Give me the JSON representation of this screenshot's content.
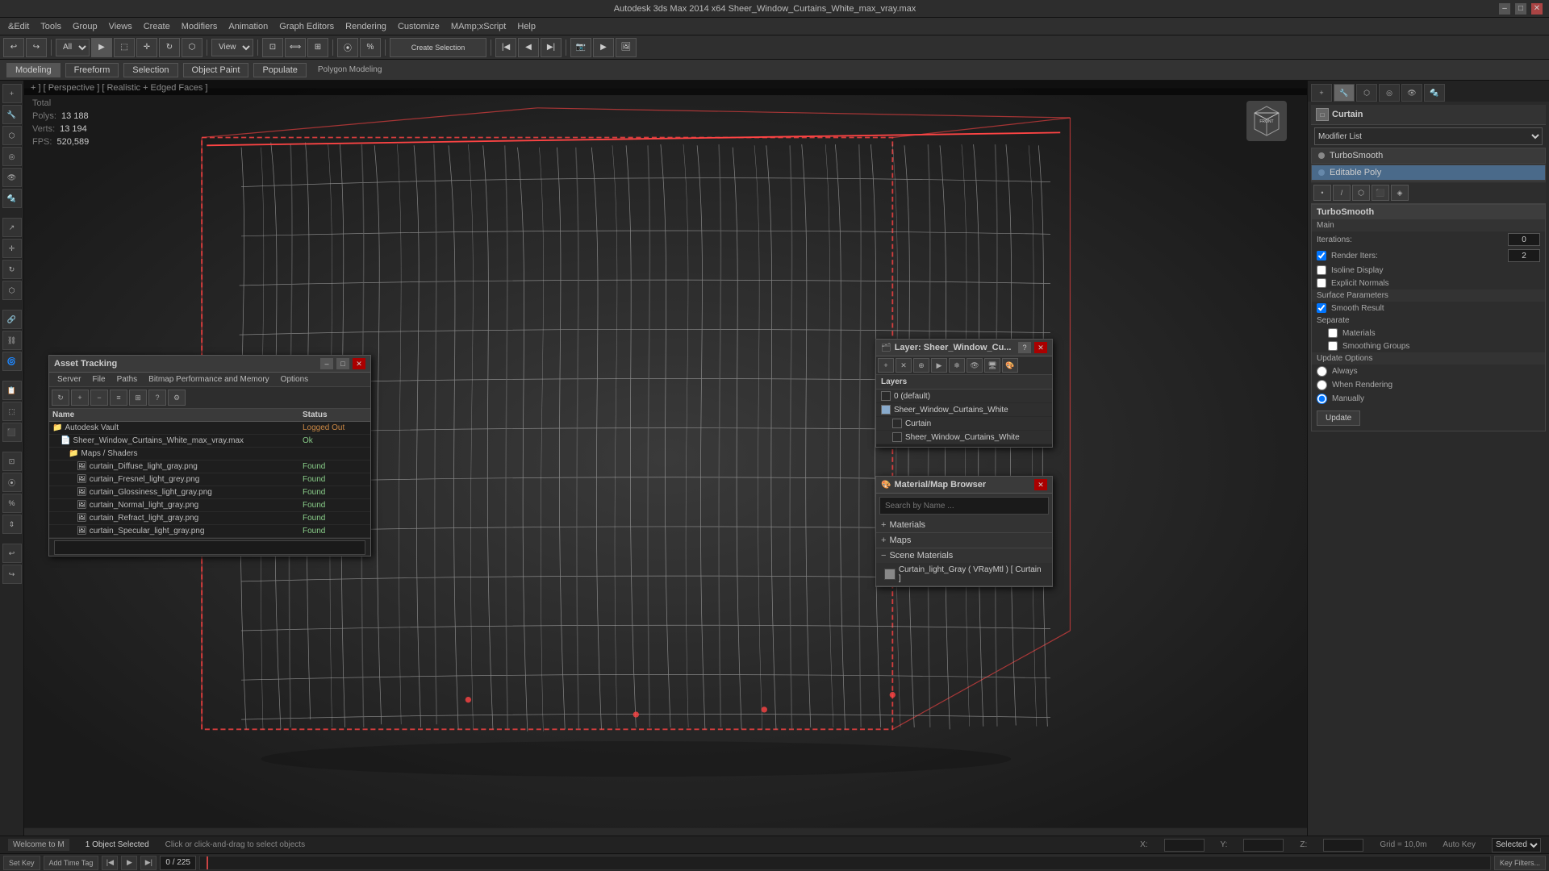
{
  "titlebar": {
    "title": "Autodesk 3ds Max  2014 x64    Sheer_Window_Curtains_White_max_vray.max",
    "minimize": "–",
    "maximize": "□",
    "close": "✕"
  },
  "menubar": {
    "items": [
      "&amp;Edit",
      "amp;Tools",
      "amp;Group",
      "amp;Views",
      "amp;Create",
      "amp;Modifiers",
      "amp;Animation",
      "Graph Editors",
      "amp;Rendering",
      "Camp;ustomize",
      "MAmp;xScript",
      "amp;Help"
    ]
  },
  "viewport": {
    "header": "+ ] [ Perspective ] [ Realistic + Edged Faces ]",
    "stats": {
      "total_label": "Total",
      "polys_label": "Polys:",
      "polys_value": "13 188",
      "verts_label": "Verts:",
      "verts_value": "13 194",
      "fps_label": "FPS:",
      "fps_value": "520,589"
    }
  },
  "right_panel": {
    "object_name": "Curtain",
    "modifier_list_label": "Modifier List",
    "modifiers": [
      {
        "name": "TurboSmooth",
        "selected": false
      },
      {
        "name": "Editable Poly",
        "selected": false
      }
    ],
    "turbsmooth": {
      "label": "TurboSmooth",
      "main_label": "Main",
      "iterations_label": "Iterations:",
      "iterations_value": "0",
      "render_iters_label": "Render Iters:",
      "render_iters_value": "2",
      "isoline_display_label": "Isoline Display",
      "explicit_normals_label": "Explicit Normals",
      "surface_params_label": "Surface Parameters",
      "smooth_result_label": "Smooth Result",
      "separate_label": "Separate",
      "materials_label": "Materials",
      "smoothing_groups_label": "Smoothing Groups",
      "update_options_label": "Update Options",
      "always_label": "Always",
      "when_rendering_label": "When Rendering",
      "manually_label": "Manually",
      "update_btn": "Update"
    }
  },
  "asset_tracking": {
    "title": "Asset Tracking",
    "menus": [
      "Seramp;ver",
      "amp;File",
      "amp;Paths",
      "amp;Bitmap Performance and Memory",
      "Opamp;tions"
    ],
    "columns": {
      "name": "Name",
      "status": "Status"
    },
    "rows": [
      {
        "level": 0,
        "icon": "folder",
        "name": "Autodesk Vault",
        "status": "Logged Out",
        "status_class": "status-loggedout"
      },
      {
        "level": 1,
        "icon": "file",
        "name": "Sheer_Window_Curtains_White_max_vray.max",
        "status": "Ok",
        "status_class": "status-ok"
      },
      {
        "level": 2,
        "icon": "folder",
        "name": "Maps / Shaders",
        "status": "",
        "status_class": ""
      },
      {
        "level": 3,
        "icon": "image",
        "name": "curtain_Diffuse_light_gray.png",
        "status": "Found",
        "status_class": "status-found"
      },
      {
        "level": 3,
        "icon": "image",
        "name": "curtain_Fresnel_light_grey.png",
        "status": "Found",
        "status_class": "status-found"
      },
      {
        "level": 3,
        "icon": "image",
        "name": "curtain_Glossiness_light_gray.png",
        "status": "Found",
        "status_class": "status-found"
      },
      {
        "level": 3,
        "icon": "image",
        "name": "curtain_Normal_light_gray.png",
        "status": "Found",
        "status_class": "status-found"
      },
      {
        "level": 3,
        "icon": "image",
        "name": "curtain_Refract_light_gray.png",
        "status": "Found",
        "status_class": "status-found"
      },
      {
        "level": 3,
        "icon": "image",
        "name": "curtain_Specular_light_gray.png",
        "status": "Found",
        "status_class": "status-found"
      }
    ]
  },
  "layers_panel": {
    "title": "Layer: Sheer_Window_Cu...",
    "layers_label": "Layers",
    "layers": [
      {
        "name": "0 (default)",
        "active": false,
        "checked": false
      },
      {
        "name": "Sheer_Window_Curtains_White",
        "active": false,
        "checked": true
      },
      {
        "name": "Curtain",
        "active": false,
        "checked": false,
        "indent": true
      },
      {
        "name": "Sheer_Window_Curtains_White",
        "active": false,
        "checked": false,
        "indent": true
      }
    ]
  },
  "material_browser": {
    "title": "Material/Map Browser",
    "search_placeholder": "Search by Name ...",
    "sections": [
      {
        "label": "+ Materials",
        "expanded": false
      },
      {
        "label": "+ Maps",
        "expanded": false
      },
      {
        "label": "- Scene Materials",
        "expanded": true
      }
    ],
    "scene_materials": [
      {
        "name": "Curtain_light_Gray ( VRayMtl ) [ Curtain ]",
        "swatch_color": "#888888"
      }
    ]
  },
  "status_bar": {
    "objects_selected": "1 Object Selected",
    "hint": "Click or click-and-drag to select objects",
    "x_label": "X:",
    "y_label": "Y:",
    "z_label": "Z:",
    "grid_label": "Grid = 10,0m",
    "autokey_label": "Auto Key",
    "selected_label": "Selected",
    "time": "0 / 225",
    "welcome": "Welcome to M"
  },
  "subbar": {
    "tabs": [
      "Modeling",
      "Freeform",
      "Selection",
      "Object Paint",
      "Populate"
    ]
  },
  "toolbar_select_label": "All",
  "toolbar_view_label": "View",
  "toolbar_create_selection_label": "Create Selection"
}
